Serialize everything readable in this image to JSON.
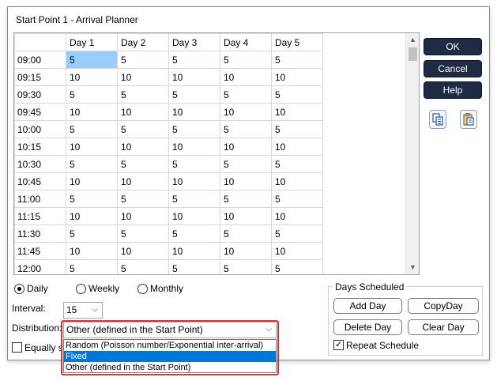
{
  "window": {
    "title": "Start Point 1 - Arrival Planner"
  },
  "grid": {
    "columns": [
      "",
      "Day 1",
      "Day 2",
      "Day 3",
      "Day 4",
      "Day 5"
    ],
    "rows": [
      {
        "time": "09:00",
        "values": [
          "5",
          "5",
          "5",
          "5",
          "5"
        ]
      },
      {
        "time": "09:15",
        "values": [
          "10",
          "10",
          "10",
          "10",
          "10"
        ]
      },
      {
        "time": "09:30",
        "values": [
          "5",
          "5",
          "5",
          "5",
          "5"
        ]
      },
      {
        "time": "09:45",
        "values": [
          "10",
          "10",
          "10",
          "10",
          "10"
        ]
      },
      {
        "time": "10:00",
        "values": [
          "5",
          "5",
          "5",
          "5",
          "5"
        ]
      },
      {
        "time": "10:15",
        "values": [
          "10",
          "10",
          "10",
          "10",
          "10"
        ]
      },
      {
        "time": "10:30",
        "values": [
          "5",
          "5",
          "5",
          "5",
          "5"
        ]
      },
      {
        "time": "10:45",
        "values": [
          "10",
          "10",
          "10",
          "10",
          "10"
        ]
      },
      {
        "time": "11:00",
        "values": [
          "5",
          "5",
          "5",
          "5",
          "5"
        ]
      },
      {
        "time": "11:15",
        "values": [
          "10",
          "10",
          "10",
          "10",
          "10"
        ]
      },
      {
        "time": "11:30",
        "values": [
          "5",
          "5",
          "5",
          "5",
          "5"
        ]
      },
      {
        "time": "11:45",
        "values": [
          "10",
          "10",
          "10",
          "10",
          "10"
        ]
      },
      {
        "time": "12:00",
        "values": [
          "5",
          "5",
          "5",
          "5",
          "5"
        ]
      }
    ]
  },
  "buttons": {
    "ok": "OK",
    "cancel": "Cancel",
    "help": "Help"
  },
  "icons": {
    "copy": "copy-icon",
    "paste": "paste-icon"
  },
  "period": {
    "daily": "Daily",
    "weekly": "Weekly",
    "monthly": "Monthly",
    "selected": "Daily"
  },
  "interval": {
    "label": "Interval:",
    "value": "15"
  },
  "distribution": {
    "label": "Distribution:",
    "value": "Other (defined in the Start Point)",
    "options": [
      "Random (Poisson number/Exponential inter-arrival)",
      "Fixed",
      "Other (defined in the Start Point)"
    ],
    "highlighted": "Fixed"
  },
  "equally": {
    "label": "Equally sp"
  },
  "days_scheduled": {
    "title": "Days Scheduled",
    "add_day": "Add Day",
    "copy_day": "CopyDay",
    "delete_day": "Delete Day",
    "clear_day": "Clear Day",
    "repeat_label": "Repeat Schedule",
    "repeat_checked": true
  },
  "colors": {
    "primary_button": "#1f2a44",
    "selection": "#99ccff",
    "highlight": "#0078d7",
    "callout": "#d9363e"
  }
}
